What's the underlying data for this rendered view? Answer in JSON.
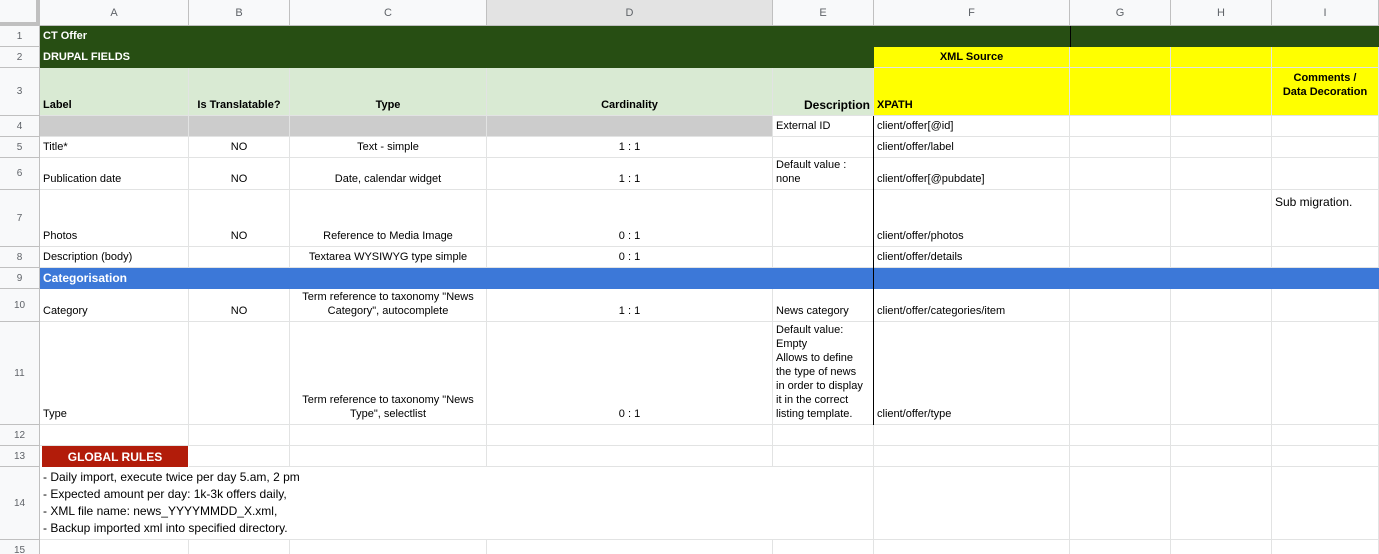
{
  "columns": [
    "A",
    "B",
    "C",
    "D",
    "E",
    "F",
    "G",
    "H",
    "I"
  ],
  "rows": [
    "1",
    "2",
    "3",
    "4",
    "5",
    "6",
    "7",
    "8",
    "9",
    "10",
    "11",
    "12",
    "13",
    "14",
    "15"
  ],
  "colors": {
    "dark_green": "#274e13",
    "light_green": "#d9ead3",
    "yellow": "#ffff00",
    "gray": "#cccccc",
    "blue": "#3c78d8",
    "red": "#b21c0a"
  },
  "row1": {
    "title": "CT Offer"
  },
  "row2": {
    "drupal_fields": "DRUPAL FIELDS",
    "xml_source": "XML Source"
  },
  "headers": {
    "label": "Label",
    "translatable": "Is Translatable?",
    "type": "Type",
    "cardinality": "Cardinality",
    "description": "Description",
    "xpath": "XPATH",
    "comments": "Comments /\nData Decoration"
  },
  "row4": {
    "description": "External ID",
    "xpath": "client/offer[@id]"
  },
  "row5": {
    "label": "Title*",
    "translatable": "NO",
    "type": "Text - simple",
    "cardinality": "1 : 1",
    "xpath": "client/offer/label"
  },
  "row6": {
    "label": "Publication date",
    "translatable": "NO",
    "type": "Date, calendar widget",
    "cardinality": "1 : 1",
    "description": "Default value :\nnone",
    "xpath": "client/offer[@pubdate]"
  },
  "row7": {
    "label": "Photos",
    "translatable": "NO",
    "type": "Reference to Media Image",
    "cardinality": "0 : 1",
    "xpath": "client/offer/photos",
    "comments": "Sub migration."
  },
  "row8": {
    "label": "Description (body)",
    "type": "Textarea WYSIWYG type simple",
    "cardinality": "0 : 1",
    "xpath": "client/offer/details"
  },
  "row9": {
    "section": "Categorisation"
  },
  "row10": {
    "label": "Category",
    "translatable": "NO",
    "type": "Term reference to taxonomy \"News\nCategory\", autocomplete",
    "cardinality": "1 : 1",
    "description": "News category",
    "xpath": "client/offer/categories/item"
  },
  "row11": {
    "label": "Type",
    "type": "Term reference to taxonomy \"News\nType\", selectlist",
    "cardinality": "0 : 1",
    "description": "Default value:\nEmpty\nAllows to define\nthe type of news\nin order to display\nit in the correct\nlisting template.",
    "xpath": "client/offer/type"
  },
  "row13": {
    "global_rules": "GLOBAL RULES"
  },
  "row14": {
    "rules": "- Daily import, execute twice per day 5.am, 2 pm\n- Expected amount per day: 1k-3k offers daily,\n- XML file name: news_YYYYMMDD_X.xml,\n- Backup imported xml into specified directory."
  }
}
